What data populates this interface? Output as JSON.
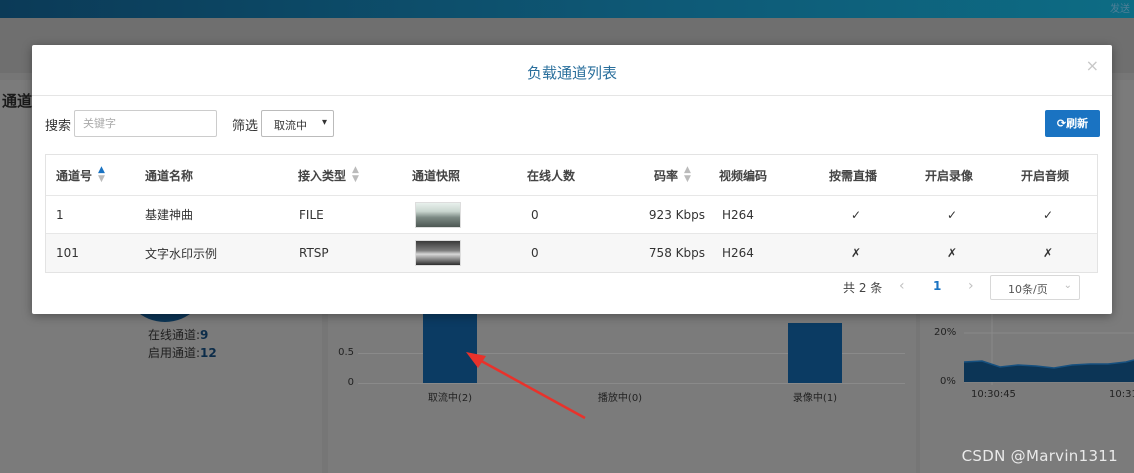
{
  "background": {
    "topbar_corner_text": "发送",
    "section_title": "通道",
    "online_label": "在线通道:",
    "online_value": "9",
    "enabled_label": "启用通道:",
    "enabled_value": "12",
    "line_chart": {
      "yticks": [
        "20%",
        "0%"
      ],
      "xticks": [
        "10:30:45",
        "10:31"
      ]
    },
    "watermark": "CSDN @Marvin1311"
  },
  "chart_data": {
    "type": "bar",
    "categories": [
      "取流中(2)",
      "播放中(0)",
      "录像中(1)"
    ],
    "values": [
      2,
      0,
      1
    ],
    "yticks": [
      "0.5",
      "0"
    ],
    "colors": {
      "bar": "#0b3b63"
    }
  },
  "modal": {
    "title": "负载通道列表",
    "close_icon": "×",
    "search_label": "搜索",
    "search_placeholder": "关键字",
    "filter_label": "筛选",
    "filter_value": "取流中",
    "refresh_label": "刷新",
    "refresh_icon": "refresh-icon",
    "columns": [
      "通道号",
      "通道名称",
      "接入类型",
      "通道快照",
      "在线人数",
      "码率",
      "视频编码",
      "按需直播",
      "开启录像",
      "开启音频"
    ],
    "rows": [
      {
        "id": "1",
        "name": "基建神曲",
        "type": "FILE",
        "online": "0",
        "bitrate": "923 Kbps",
        "codec": "H264",
        "on_demand": "✓",
        "record": "✓",
        "audio": "✓"
      },
      {
        "id": "101",
        "name": "文字水印示例",
        "type": "RTSP",
        "online": "0",
        "bitrate": "758 Kbps",
        "codec": "H264",
        "on_demand": "✗",
        "record": "✗",
        "audio": "✗"
      }
    ],
    "pagination": {
      "total_text": "共 2 条",
      "prev": "‹",
      "current_page": "1",
      "next": "›",
      "page_size": "10条/页"
    },
    "colors": {
      "accent": "#1a73c2",
      "title": "#2a6f9c"
    }
  }
}
